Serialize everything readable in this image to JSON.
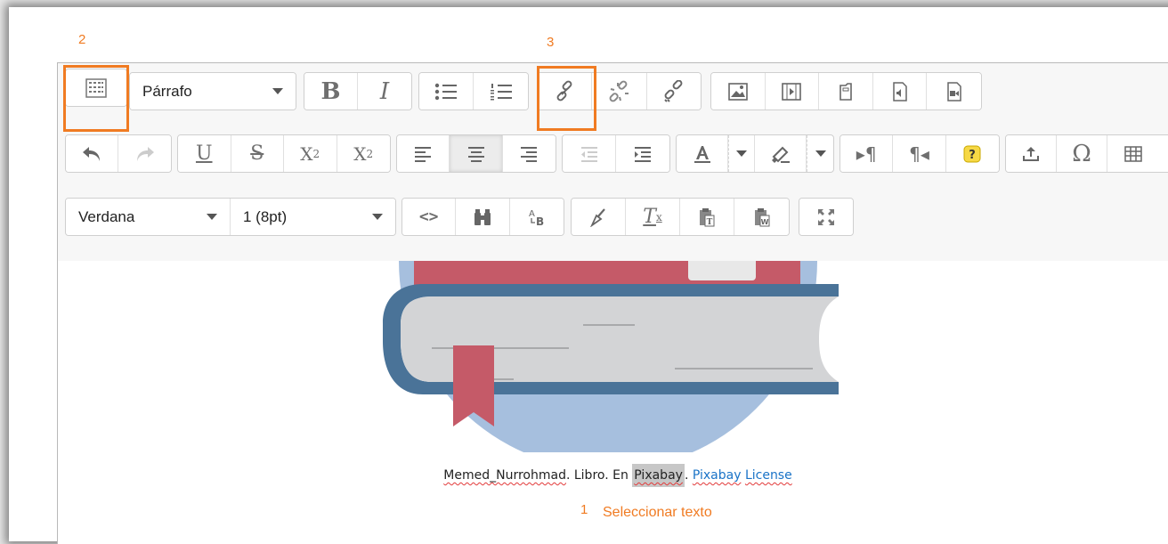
{
  "annotations": {
    "a1": "1",
    "a1_text": "Seleccionar texto",
    "a2": "2",
    "a3": "3"
  },
  "toolbar": {
    "format_select": "Párrafo",
    "font_select": "Verdana",
    "size_select": "1 (8pt)"
  },
  "caption": {
    "author": "Memed_Nurrohmad",
    "sep1": ". Libro. En ",
    "source": "Pixabay",
    "sep2": ". ",
    "license_1": "Pixabay",
    "license_2": "License"
  },
  "colors": {
    "annotation": "#f07b22",
    "link": "#1a73c7",
    "book_blue": "#4a7398",
    "book_red": "#c55a68",
    "circle": "#a6bfde"
  }
}
